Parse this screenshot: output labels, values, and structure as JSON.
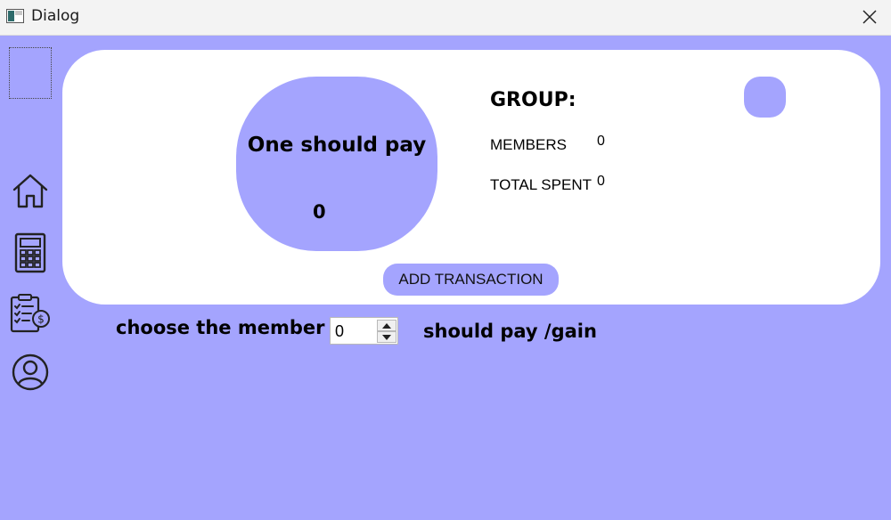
{
  "window": {
    "title": "Dialog"
  },
  "summary": {
    "pay_label": "One should pay",
    "pay_value": "0"
  },
  "group": {
    "title": "GROUP:",
    "members_label": "MEMBERS",
    "members_value": "0",
    "total_label": "TOTAL SPENT",
    "total_value": "0"
  },
  "actions": {
    "add_transaction": "ADD TRANSACTION"
  },
  "member_picker": {
    "label": "choose the member",
    "value": "0",
    "suffix": "should pay /gain"
  },
  "nav": [
    "home-icon",
    "calculator-icon",
    "clipboard-money-icon",
    "user-icon"
  ],
  "colors": {
    "background": "#a4a4fe",
    "card": "#ffffff",
    "accent": "#a4a4fe"
  }
}
